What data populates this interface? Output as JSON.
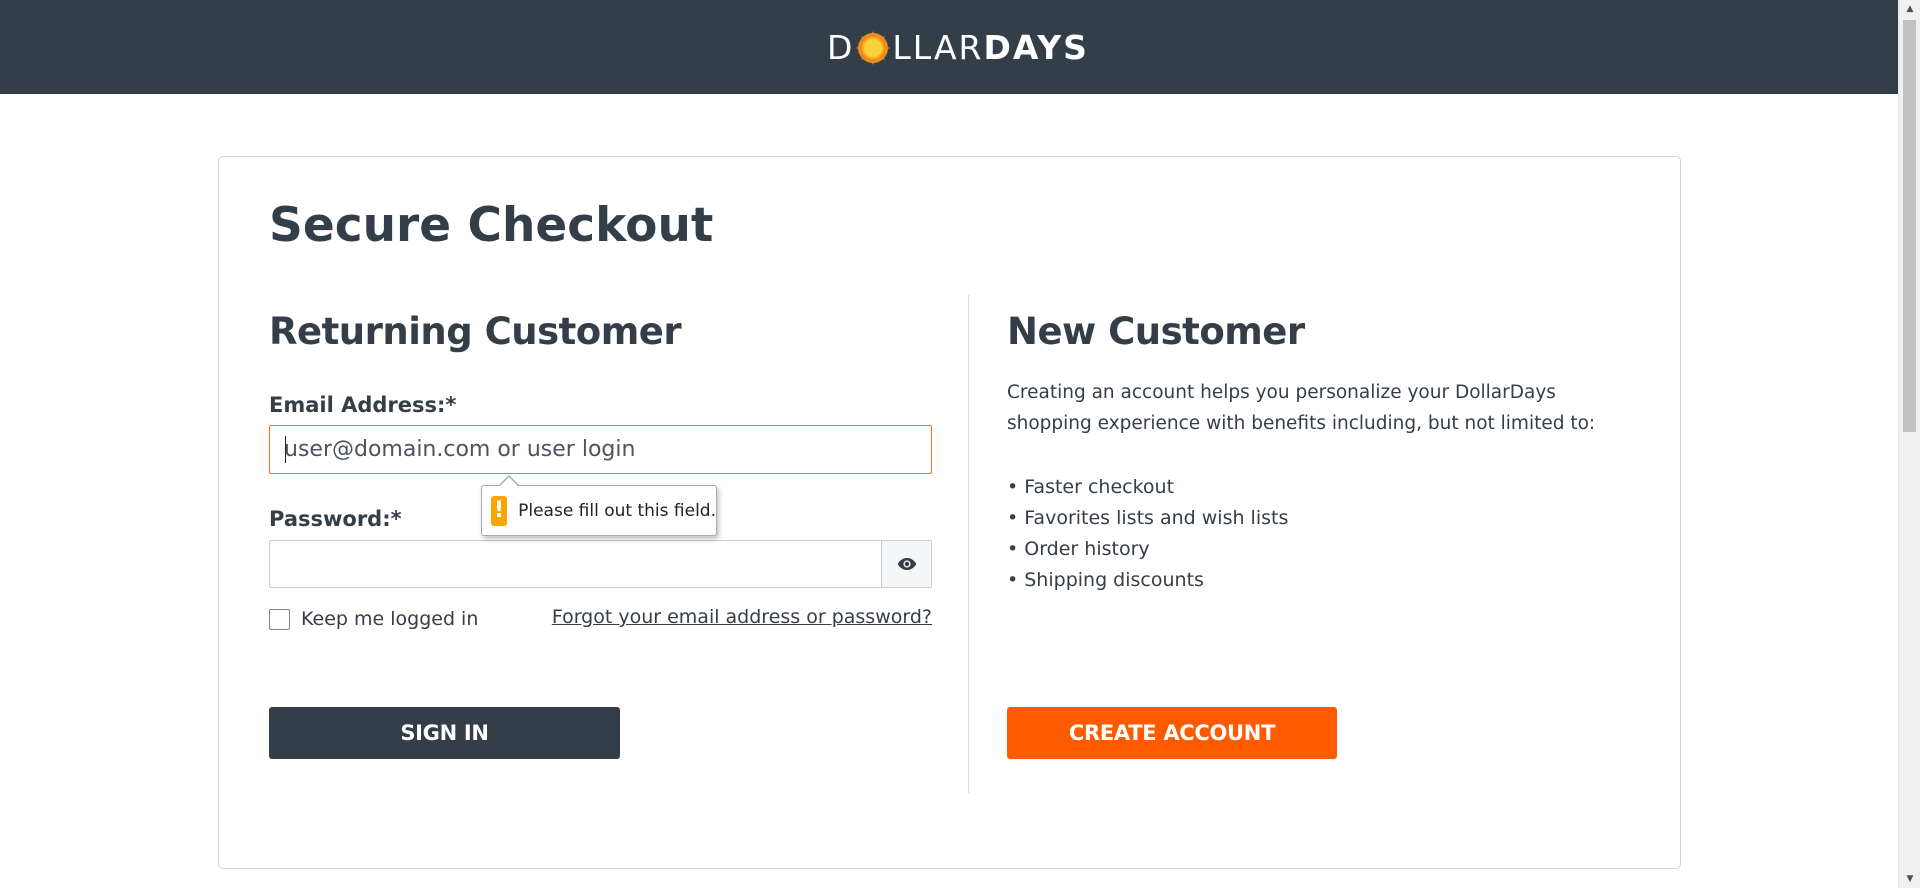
{
  "header": {
    "logo": {
      "text_left": "D",
      "text_middle": "LLAR",
      "text_right": "DAYS",
      "sun_color": "#f7b21c",
      "sun_ray_color": "#f18a1c"
    },
    "background_color": "#343e48"
  },
  "checkout": {
    "title": "Secure Checkout",
    "returning": {
      "heading": "Returning Customer",
      "email_label": "Email Address:*",
      "email_placeholder": "user@domain.com or user login",
      "email_value": "",
      "validation_message": "Please fill out this field.",
      "password_label": "Password:*",
      "password_value": "",
      "keep_logged_in_label": "Keep me logged in",
      "keep_logged_in_checked": false,
      "forgot_link": "Forgot your email address or password?",
      "sign_in_button": "SIGN IN"
    },
    "new_customer": {
      "heading": "New Customer",
      "intro": "Creating an account helps you personalize your DollarDays shopping experience with benefits including, but not limited to:",
      "benefits": [
        "Faster checkout",
        "Favorites lists and wish lists",
        "Order history",
        "Shipping discounts"
      ],
      "create_account_button": "CREATE ACCOUNT"
    }
  },
  "colors": {
    "primary_dark": "#343e48",
    "accent_orange": "#ff5a00",
    "focus_border": "#ff6c1f",
    "warning": "#f8a505"
  },
  "icons": {
    "password_toggle": "eye-icon",
    "validation": "warning-icon",
    "logo_sun": "sun-icon"
  }
}
